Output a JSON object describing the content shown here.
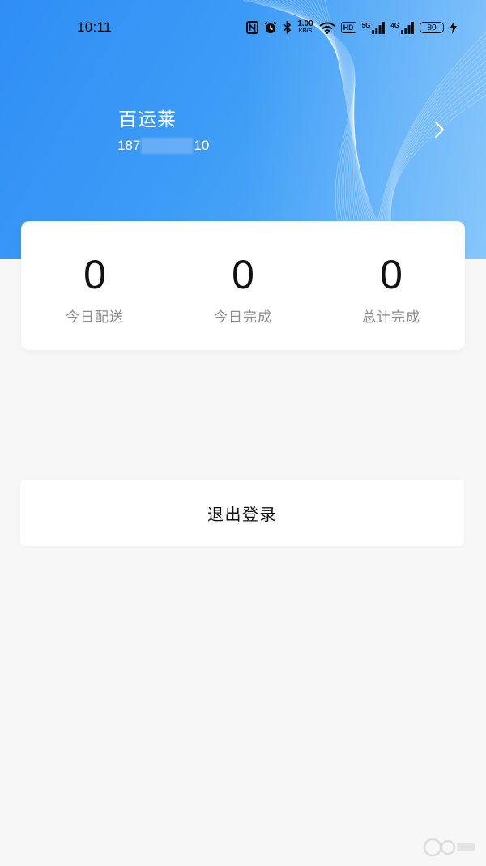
{
  "status_bar": {
    "time": "10:11",
    "net_speed_value": "1.00",
    "net_speed_unit": "KB/S",
    "hd_label": "HD",
    "sim1_label": "5G",
    "sim2_label": "4G",
    "battery": "80",
    "icons": [
      "nfc-icon",
      "alarm-icon",
      "bluetooth-icon",
      "wifi-icon",
      "hd-icon",
      "signal-icon",
      "battery-icon",
      "charging-icon"
    ]
  },
  "profile": {
    "name": "百运莱",
    "phone_prefix": "187",
    "phone_suffix": "10"
  },
  "stats": [
    {
      "value": "0",
      "label": "今日配送"
    },
    {
      "value": "0",
      "label": "今日完成"
    },
    {
      "value": "0",
      "label": "总计完成"
    }
  ],
  "logout": {
    "label": "退出登录"
  },
  "colors": {
    "header_blue": "#2f8ef5",
    "background": "#f7f7f7",
    "card": "#ffffff"
  }
}
